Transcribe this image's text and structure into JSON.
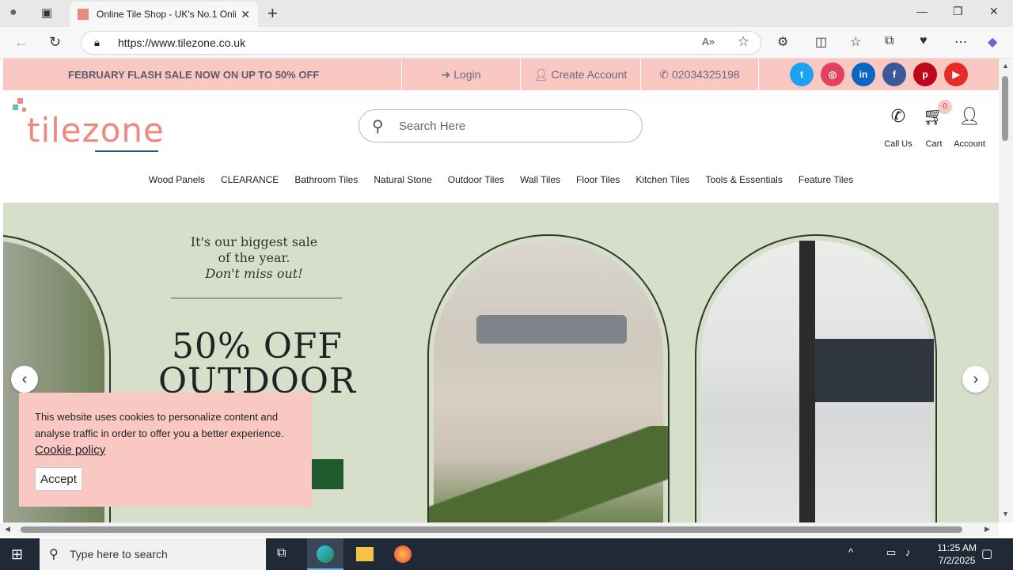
{
  "browser": {
    "tab_title": "Online Tile Shop - UK's No.1 Onli",
    "url": "https://www.tilezone.co.uk"
  },
  "topbar": {
    "sale_text": "FEBRUARY FLASH SALE NOW ON UP TO 50% OFF",
    "login": "Login",
    "create_account": "Create Account",
    "phone": "02034325198",
    "social": [
      {
        "icon": "twitter-icon",
        "glyph": "t",
        "color": "#1da1f2"
      },
      {
        "icon": "instagram-icon",
        "glyph": "◎",
        "color": "#e4405f"
      },
      {
        "icon": "linkedin-icon",
        "glyph": "in",
        "color": "#0a66c2"
      },
      {
        "icon": "facebook-icon",
        "glyph": "f",
        "color": "#3b5998"
      },
      {
        "icon": "pinterest-icon",
        "glyph": "p",
        "color": "#bd081c"
      },
      {
        "icon": "youtube-icon",
        "glyph": "▶",
        "color": "#e52d27"
      }
    ]
  },
  "header": {
    "logo_text": "tilezone",
    "search_placeholder": "Search Here",
    "call_us": "Call Us",
    "cart": "Cart",
    "cart_count": "0",
    "account": "Account"
  },
  "menu": [
    "Wood Panels",
    "CLEARANCE",
    "Bathroom Tiles",
    "Natural Stone",
    "Outdoor Tiles",
    "Wall Tiles",
    "Floor Tiles",
    "Kitchen Tiles",
    "Tools & Essentials",
    "Feature Tiles"
  ],
  "hero": {
    "line1": "It's our biggest sale",
    "line2": "of the year.",
    "line3": "Don't miss out!",
    "big1": "50% OFF",
    "big2": "OUTDOOR"
  },
  "cookie": {
    "text": "This website uses cookies to personalize content and analyse traffic in order to offer you a better experience.",
    "link": "Cookie policy",
    "accept": "Accept"
  },
  "taskbar": {
    "search_placeholder": "Type here to search",
    "time": "11:25 AM",
    "date": "7/2/2025"
  },
  "colors": {
    "pink": "#f9c8c3",
    "hero_bg": "#d7dfcb"
  }
}
